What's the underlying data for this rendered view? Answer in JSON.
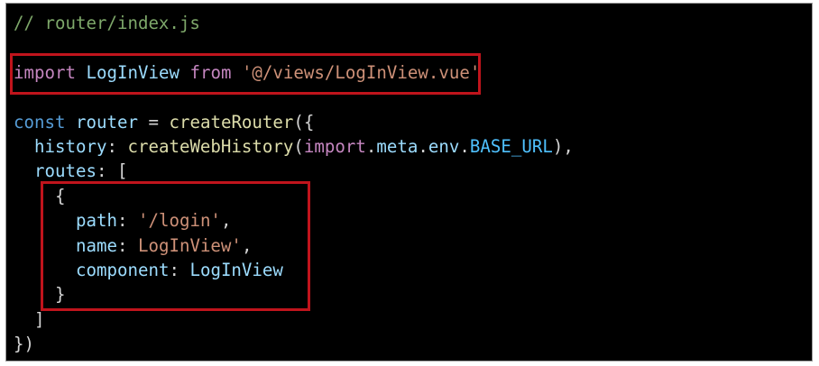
{
  "code_lines": [
    {
      "comment": "// router/index.js"
    },
    {},
    {
      "kw_import": "import",
      "ident1": "LogInView",
      "kw_from": "from",
      "str": "'@/views/LogInView.vue'"
    },
    {},
    {
      "kw_const": "const",
      "ident": "router",
      "op": "=",
      "fn": "createRouter",
      "punc": "({"
    },
    {
      "prop": "history",
      "colon": ":",
      "fn": "createWebHistory",
      "open": "(",
      "kw_import": "import",
      "dot1": ".",
      "meta": "meta",
      "dot2": ".",
      "env": "env",
      "dot3": ".",
      "const": "BASE_URL",
      "close": "),"
    },
    {
      "prop": "routes",
      "colon": ":",
      "punc": "["
    },
    {
      "punc": "{"
    },
    {
      "prop": "path",
      "colon": ":",
      "str": "'/login'",
      "comma": ","
    },
    {
      "prop": "name",
      "colon": ":",
      "str": "LogInView'",
      "comma": ","
    },
    {
      "prop": "component",
      "colon": ":",
      "ident": "LogInView"
    },
    {
      "punc": "}"
    },
    {
      "punc": "]"
    },
    {
      "punc": "})"
    }
  ],
  "colors": {
    "background": "#000000",
    "highlight_border": "#c0141c"
  }
}
